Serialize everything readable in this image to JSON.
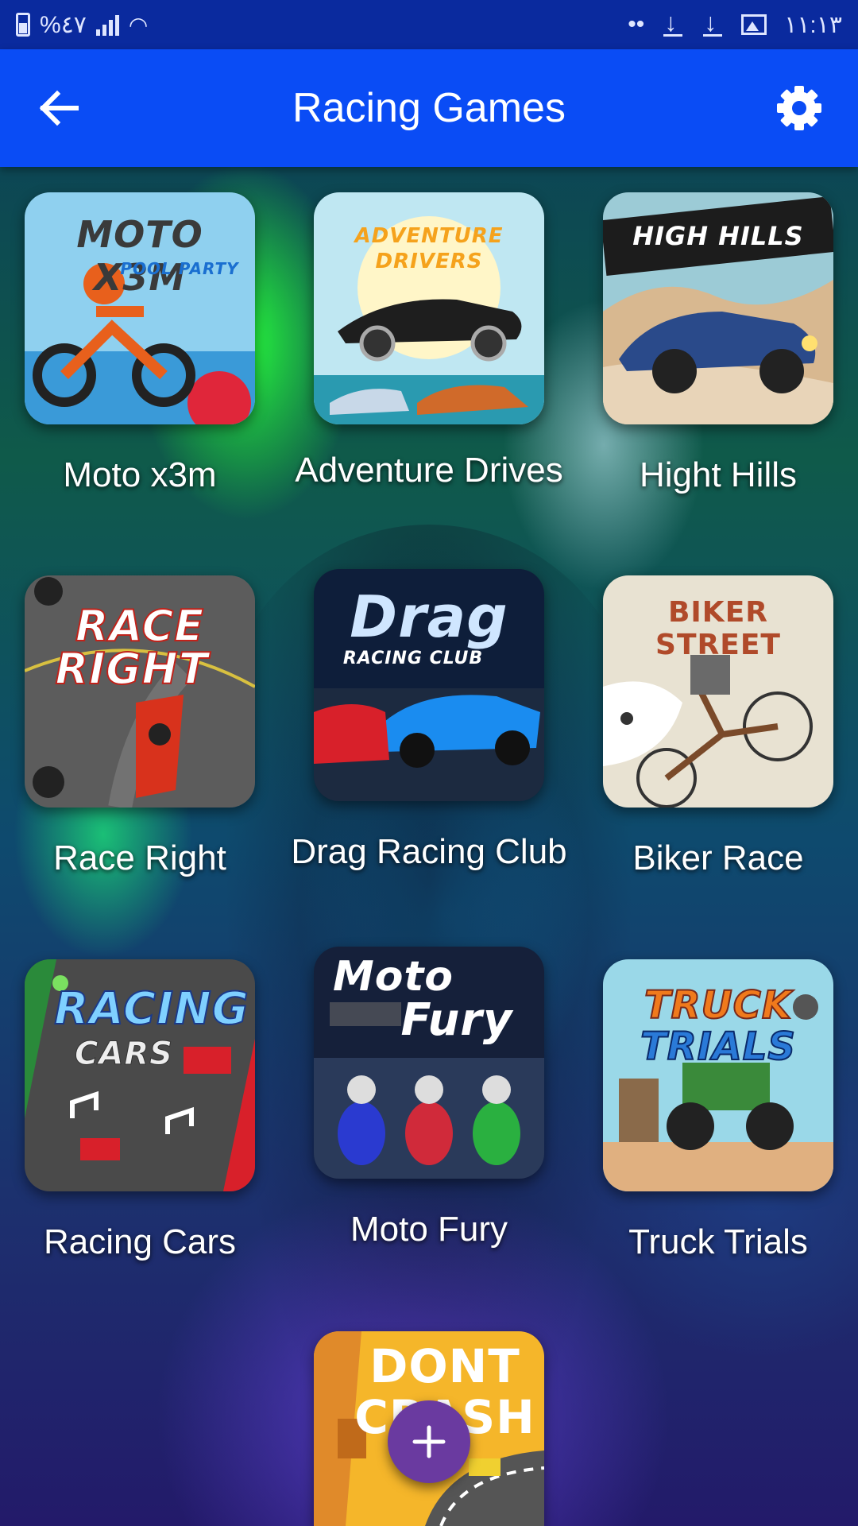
{
  "status_bar": {
    "battery_text": "%٤٧",
    "time": "١١:١٣",
    "dots": "••"
  },
  "appbar": {
    "title": "Racing Games",
    "back_icon": "arrow-left-icon",
    "settings_icon": "gear-icon",
    "color": "#0a4cf5"
  },
  "games": [
    {
      "label": "Moto x3m",
      "art_text": "MOTO X3M",
      "art_subtext": "POOL PARTY"
    },
    {
      "label": "Adventure Drives",
      "art_text": "ADVENTURE",
      "art_subtext": "DRIVERS"
    },
    {
      "label": "Hight Hills",
      "art_text": "HIGH HILLS",
      "art_subtext": ""
    },
    {
      "label": "Race Right",
      "art_text": "RACE",
      "art_subtext": "RIGHT"
    },
    {
      "label": "Drag Racing Club",
      "art_text": "Drag",
      "art_subtext": "RACING CLUB"
    },
    {
      "label": "Biker Race",
      "art_text": "BIKER STREET",
      "art_subtext": ""
    },
    {
      "label": "Racing Cars",
      "art_text": "RACING",
      "art_subtext": "CARS"
    },
    {
      "label": "Moto Fury",
      "art_text": "Moto",
      "art_subtext": "Fury"
    },
    {
      "label": "Truck Trials",
      "art_text": "TRUCK",
      "art_subtext": "TRIALS"
    },
    {
      "label": "",
      "art_text": "DONT",
      "art_subtext": "CRASH"
    }
  ],
  "fab": {
    "icon": "plus-icon",
    "color": "#6a3aa0"
  }
}
